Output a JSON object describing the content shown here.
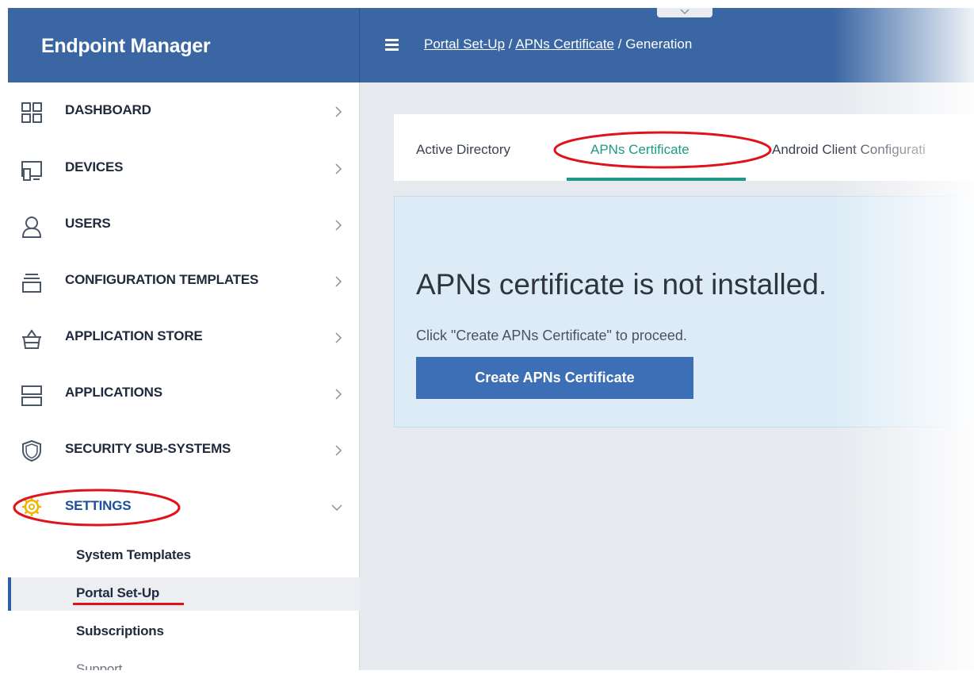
{
  "app": {
    "title": "Endpoint Manager"
  },
  "header": {
    "breadcrumb": [
      {
        "label": "Portal Set-Up",
        "link": true
      },
      {
        "label": "APNs Certificate",
        "link": true
      },
      {
        "label": "Generation",
        "link": false
      }
    ],
    "separator": "/"
  },
  "sidebar": {
    "items": [
      {
        "label": "DASHBOARD",
        "icon": "dashboard-grid-icon"
      },
      {
        "label": "DEVICES",
        "icon": "devices-icon"
      },
      {
        "label": "USERS",
        "icon": "user-icon"
      },
      {
        "label": "CONFIGURATION TEMPLATES",
        "icon": "templates-icon"
      },
      {
        "label": "APPLICATION STORE",
        "icon": "store-basket-icon"
      },
      {
        "label": "APPLICATIONS",
        "icon": "applications-icon"
      },
      {
        "label": "SECURITY SUB-SYSTEMS",
        "icon": "shield-icon"
      },
      {
        "label": "SETTINGS",
        "icon": "gear-icon",
        "expanded": true
      }
    ],
    "settings_sub": [
      {
        "label": "System Templates"
      },
      {
        "label": "Portal Set-Up",
        "active": true
      },
      {
        "label": "Subscriptions"
      },
      {
        "label": "Support"
      }
    ]
  },
  "tabs": [
    {
      "label": "Active Directory",
      "active": false
    },
    {
      "label": "APNs Certificate",
      "active": true
    },
    {
      "label": "Android Client Configurati",
      "active": false
    }
  ],
  "panel": {
    "heading": "APNs certificate is not installed.",
    "hint": "Click \"Create APNs Certificate\" to proceed.",
    "button_label": "Create APNs Certificate"
  },
  "colors": {
    "header": "#3a66a3",
    "accent_tab": "#1e9a86",
    "button": "#3d6fb6",
    "annotation": "#e0131b",
    "panel": "#dcebf6",
    "gear": "#f0b400"
  }
}
